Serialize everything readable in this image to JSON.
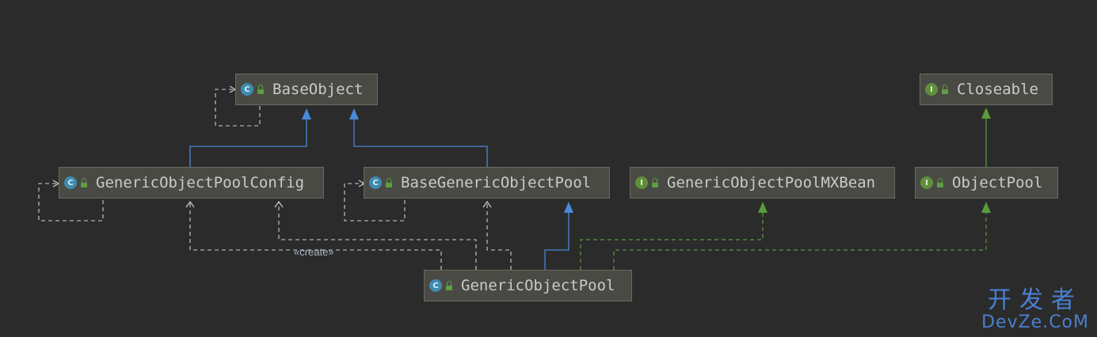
{
  "nodes": {
    "base_object": {
      "label": "BaseObject",
      "kind": "C"
    },
    "closeable": {
      "label": "Closeable",
      "kind": "I"
    },
    "generic_object_pool_config": {
      "label": "GenericObjectPoolConfig",
      "kind": "C"
    },
    "base_generic_object_pool": {
      "label": "BaseGenericObjectPool",
      "kind": "C"
    },
    "generic_object_pool_mxbean": {
      "label": "GenericObjectPoolMXBean",
      "kind": "I"
    },
    "object_pool": {
      "label": "ObjectPool",
      "kind": "I"
    },
    "generic_object_pool": {
      "label": "GenericObjectPool",
      "kind": "C"
    }
  },
  "edges": {
    "create_stereotype": "«create»"
  },
  "colors": {
    "extends_line": "#4a88d8",
    "implements_line": "#5a9a3a",
    "dependency_line": "#cfcfcf"
  },
  "watermark": {
    "cn": "开发者",
    "en": "DevZe.CoM"
  }
}
